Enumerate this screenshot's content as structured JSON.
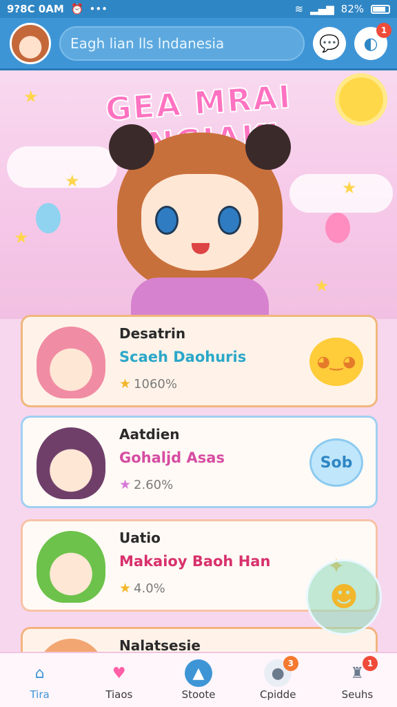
{
  "status_bar": {
    "time": "9?8C 0AM",
    "battery": "82%"
  },
  "header": {
    "search_text": "Eagh lian lls lndanesia",
    "chat_icon": "chat-bubble-icon",
    "profile_icon": "profile-icon",
    "notification_count": "1"
  },
  "hero": {
    "title": "GEA MRAI ANGIAKI"
  },
  "cards": [
    {
      "name": "Desatrin",
      "subtitle": "Scaeh Daohuris",
      "rating": "1060%",
      "action_icon": "smile-sticker-icon",
      "subtitle_color": "#2aa7c9",
      "action_bg": "#ffcc3a",
      "action_text": ""
    },
    {
      "name": "Aatdien",
      "subtitle": "Gohaljd Asas",
      "rating": "2.60%",
      "action_icon": "speech-bubble-icon",
      "subtitle_color": "#d64ca2",
      "action_bg": "#bfe6fb",
      "action_text": "Sob"
    },
    {
      "name": "Uatio",
      "subtitle": "Makaioy Baoh Han",
      "rating": "4.0%",
      "action_icon": "sparkle-icon",
      "subtitle_color": "#d8306c",
      "action_bg": "#ffffff",
      "action_text": ""
    },
    {
      "name": "Nalatsesie",
      "subtitle": "",
      "rating": "",
      "action_icon": "",
      "subtitle_color": "#2a2a2a",
      "action_bg": "#ffffff",
      "action_text": ""
    }
  ],
  "bottom_nav": [
    {
      "label": "Tira",
      "icon": "home-icon",
      "badge": ""
    },
    {
      "label": "Tiaos",
      "icon": "heart-icon",
      "badge": ""
    },
    {
      "label": "Stoote",
      "icon": "store-icon",
      "badge": ""
    },
    {
      "label": "Cpidde",
      "icon": "chat-icon",
      "badge": "3"
    },
    {
      "label": "Seuhs",
      "icon": "bell-icon",
      "badge": "1"
    }
  ],
  "colors": {
    "primary": "#3e95d6",
    "status": "#2f86c4",
    "background": "#f7d7ee",
    "accent": "#ff72c1"
  }
}
